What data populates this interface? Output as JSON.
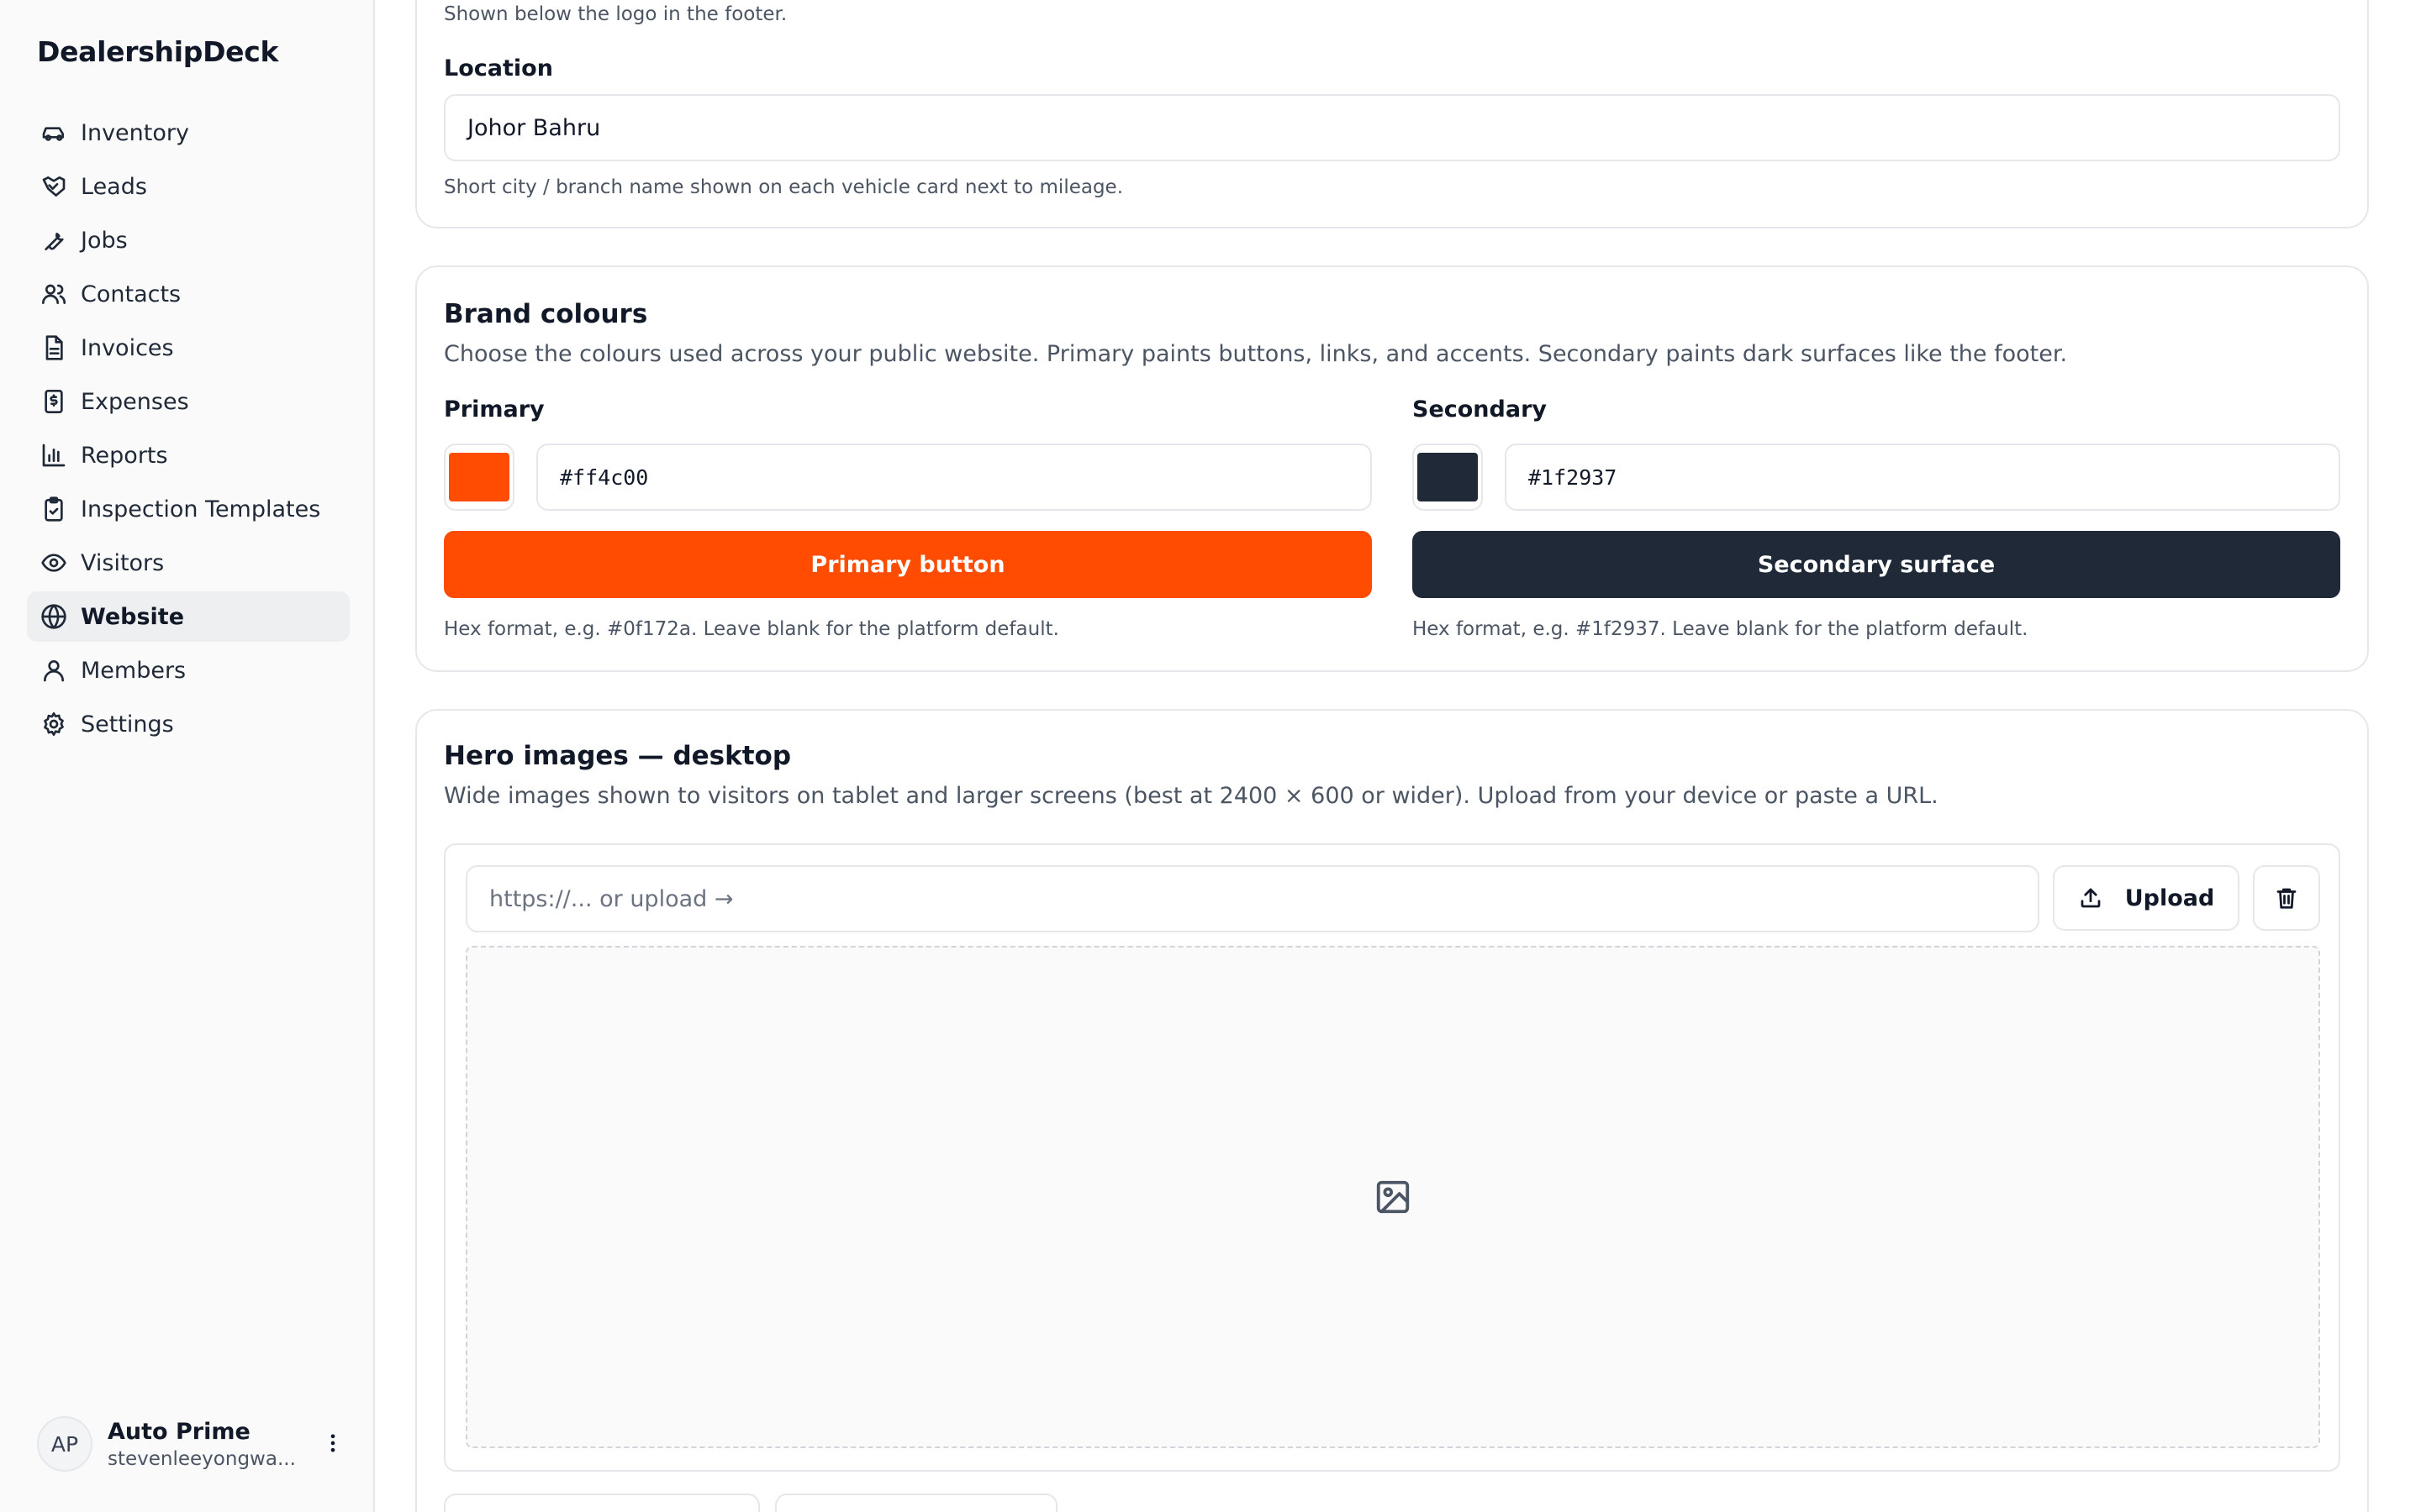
{
  "app": {
    "brand": "DealershipDeck"
  },
  "sidebar": {
    "items": [
      {
        "label": "Inventory",
        "icon": "car-icon"
      },
      {
        "label": "Leads",
        "icon": "handshake-icon"
      },
      {
        "label": "Jobs",
        "icon": "wrench-icon"
      },
      {
        "label": "Contacts",
        "icon": "users-icon"
      },
      {
        "label": "Invoices",
        "icon": "file-text-icon"
      },
      {
        "label": "Expenses",
        "icon": "receipt-icon"
      },
      {
        "label": "Reports",
        "icon": "bar-chart-icon"
      },
      {
        "label": "Inspection Templates",
        "icon": "clipboard-check-icon"
      },
      {
        "label": "Visitors",
        "icon": "eye-icon"
      },
      {
        "label": "Website",
        "icon": "globe-icon",
        "active": true
      },
      {
        "label": "Members",
        "icon": "user-icon"
      },
      {
        "label": "Settings",
        "icon": "gear-icon"
      }
    ],
    "user": {
      "initials": "AP",
      "name": "Auto Prime",
      "email": "stevenleeyongwa..."
    }
  },
  "footer_card": {
    "top_hint": "Shown below the logo in the footer.",
    "location_label": "Location",
    "location_value": "Johor Bahru",
    "location_hint": "Short city / branch name shown on each vehicle card next to mileage."
  },
  "brand_colours": {
    "title": "Brand colours",
    "description": "Choose the colours used across your public website. Primary paints buttons, links, and accents. Secondary paints dark surfaces like the footer.",
    "primary": {
      "label": "Primary",
      "value": "#ff4c00",
      "color": "#ff4c00",
      "preview_label": "Primary button",
      "hint": "Hex format, e.g. #0f172a. Leave blank for the platform default."
    },
    "secondary": {
      "label": "Secondary",
      "value": "#1f2937",
      "color": "#1f2937",
      "preview_label": "Secondary surface",
      "hint": "Hex format, e.g. #1f2937. Leave blank for the platform default."
    }
  },
  "hero": {
    "title": "Hero images — desktop",
    "description": "Wide images shown to visitors on tablet and larger screens (best at 2400 × 600 or wider). Upload from your device or paste a URL.",
    "url_placeholder": "https://... or upload →",
    "upload_label": "Upload"
  }
}
